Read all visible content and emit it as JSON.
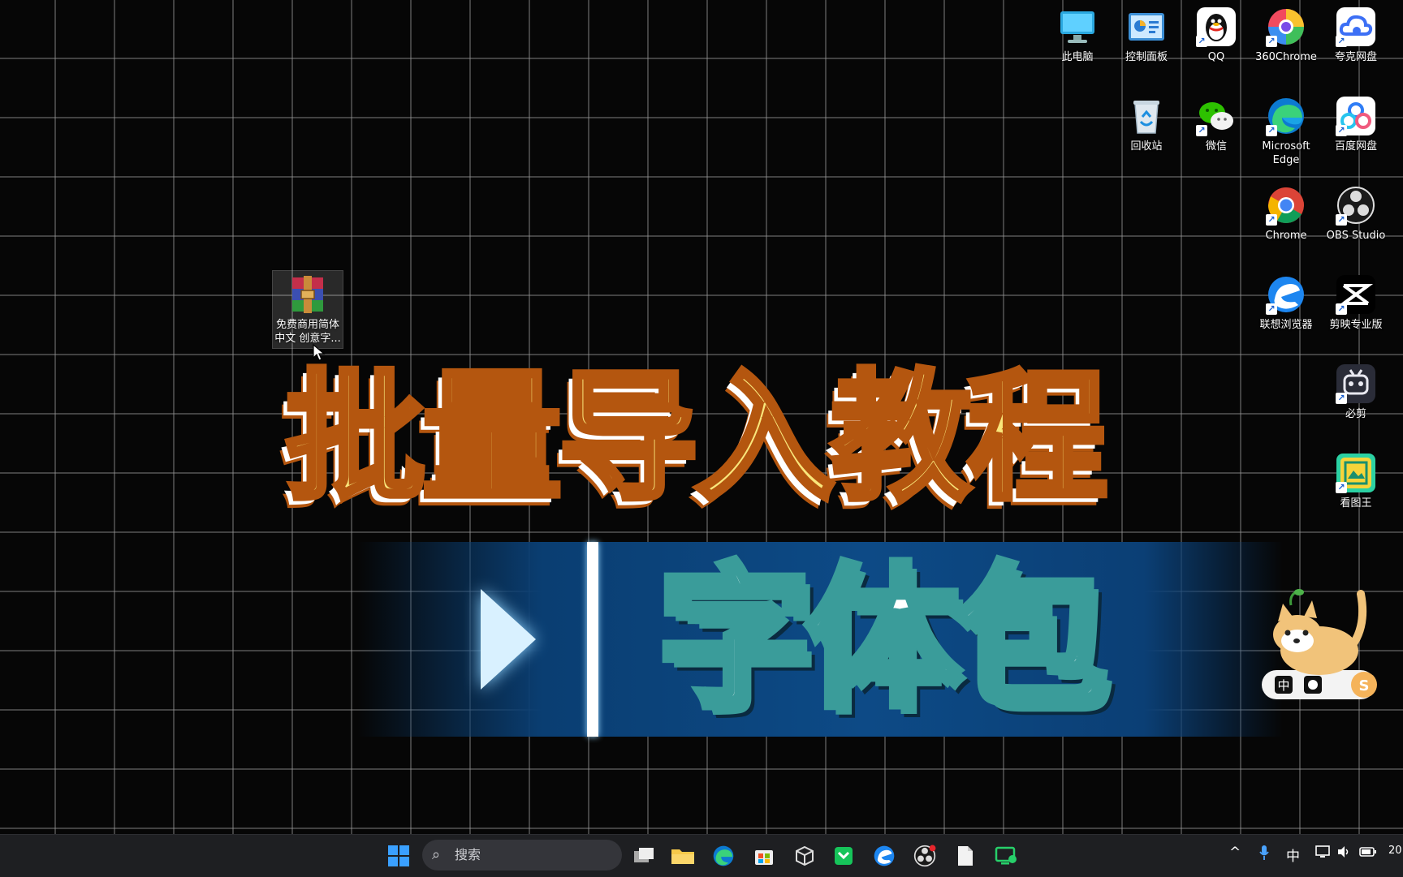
{
  "desktop_icons": [
    {
      "name": "this-pc",
      "label": "此电脑"
    },
    {
      "name": "control-panel",
      "label": "控制面板"
    },
    {
      "name": "qq",
      "label": "QQ"
    },
    {
      "name": "360chrome",
      "label": "360Chrome"
    },
    {
      "name": "quark-drive",
      "label": "夸克网盘"
    },
    {
      "name": "recycle-bin",
      "label": "回收站"
    },
    {
      "name": "wechat",
      "label": "微信"
    },
    {
      "name": "microsoft-edge",
      "label": "Microsoft Edge"
    },
    {
      "name": "baidu-netdisk",
      "label": "百度网盘"
    },
    {
      "name": "chrome",
      "label": "Chrome"
    },
    {
      "name": "obs-studio",
      "label": "OBS Studio"
    },
    {
      "name": "lenovo-browser",
      "label": "联想浏览器"
    },
    {
      "name": "capcut-pro",
      "label": "剪映专业版"
    },
    {
      "name": "bijian",
      "label": "必剪"
    },
    {
      "name": "kantuwang",
      "label": "看图王"
    },
    {
      "name": "font-archive",
      "label": "免费商用简体中文 创意字..."
    }
  ],
  "banner": {
    "title": "批量导入教程",
    "subtitle": "字体包"
  },
  "taskbar": {
    "search_placeholder": "搜索",
    "ime_indicator": "中",
    "clock_fragment": "20"
  },
  "colors": {
    "title_fill": "#f9e67b",
    "title_stroke": "#b4560f",
    "subtitle_stroke": "#3a9c9a",
    "band": "#0d4a86"
  }
}
